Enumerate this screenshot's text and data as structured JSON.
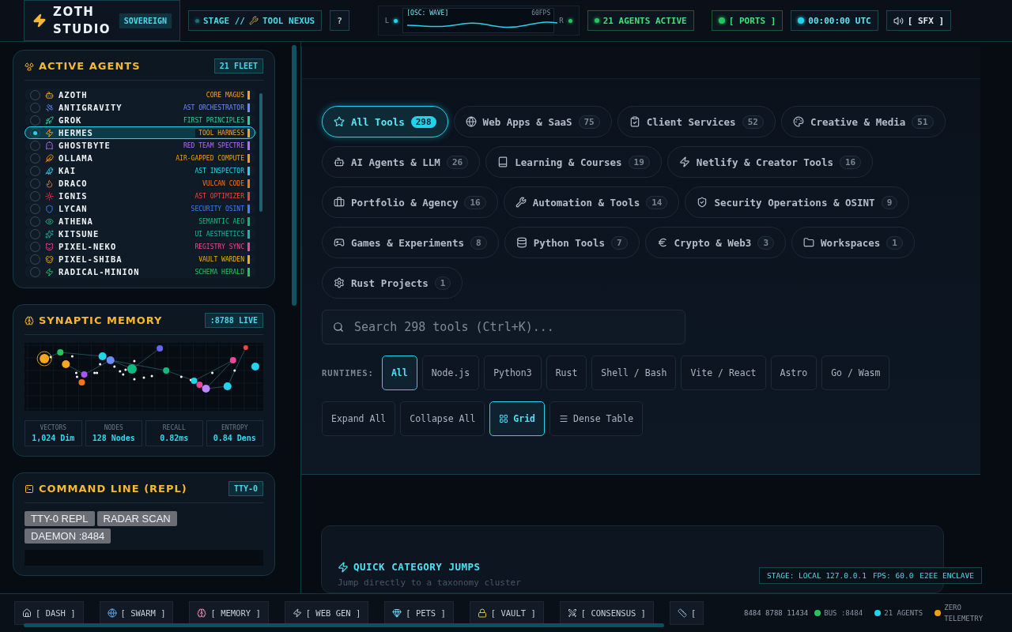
{
  "topbar": {
    "brand": "ZOTH STUDIO",
    "badge": "SOVEREIGN",
    "stage": {
      "prefix": "STAGE //",
      "label": "TOOL NEXUS"
    },
    "help": "?",
    "osc": {
      "left": "L",
      "right": "R",
      "title": "[OSC: WAVE]",
      "fps": "60FPS"
    },
    "agents_status": "21 AGENTS ACTIVE",
    "ports": "[ PORTS ]",
    "clock": "00:00:00 UTC",
    "sfx": "[ SFX ]"
  },
  "agents_panel": {
    "title": "ACTIVE AGENTS",
    "badge": "21 FLEET",
    "agents": [
      {
        "name": "AZOTH",
        "role": "CORE MAGUS",
        "color": "#f5a623",
        "selected": false
      },
      {
        "name": "ANTIGRAVITY",
        "role": "AST ORCHESTRATOR",
        "color": "#6b8cff",
        "selected": false
      },
      {
        "name": "GROK",
        "role": "FIRST PRINCIPLES",
        "color": "#2ecc9a",
        "selected": false
      },
      {
        "name": "HERMES",
        "role": "TOOL HARNESS",
        "color": "#f5a623",
        "selected": true
      },
      {
        "name": "GHOSTBYTE",
        "role": "RED TEAM SPECTRE",
        "color": "#b76cff",
        "selected": false
      },
      {
        "name": "OLLAMA",
        "role": "AIR-GAPPED COMPUTE",
        "color": "#f59e0b",
        "selected": false
      },
      {
        "name": "KAI",
        "role": "AST INSPECTOR",
        "color": "#22d3ee",
        "selected": false
      },
      {
        "name": "DRACO",
        "role": "VULCAN CODE",
        "color": "#f97316",
        "selected": false
      },
      {
        "name": "IGNIS",
        "role": "AST OPTIMIZER",
        "color": "#ef4444",
        "selected": false
      },
      {
        "name": "LYCAN",
        "role": "SECURITY OSINT",
        "color": "#3b82f6",
        "selected": false
      },
      {
        "name": "ATHENA",
        "role": "SEMANTIC AEO",
        "color": "#10b981",
        "selected": false
      },
      {
        "name": "KITSUNE",
        "role": "UI AESTHETICS",
        "color": "#14b8a6",
        "selected": false
      },
      {
        "name": "PIXEL-NEKO",
        "role": "REGISTRY SYNC",
        "color": "#ec4899",
        "selected": false
      },
      {
        "name": "PIXEL-SHIBA",
        "role": "VAULT WARDEN",
        "color": "#eab308",
        "selected": false
      },
      {
        "name": "RADICAL-MINION",
        "role": "SCHEMA HERALD",
        "color": "#22c55e",
        "selected": false
      }
    ]
  },
  "memory_panel": {
    "title": "SYNAPTIC MEMORY",
    "badge": ":8788 LIVE",
    "stats": [
      {
        "label": "VECTORS",
        "value": "1,024 Dim"
      },
      {
        "label": "NODES",
        "value": "128 Nodes"
      },
      {
        "label": "RECALL",
        "value": "0.82ms"
      },
      {
        "label": "ENTROPY",
        "value": "0.84 Dens"
      }
    ]
  },
  "repl_panel": {
    "title": "COMMAND LINE (REPL)",
    "badge": "TTY-0",
    "buttons": [
      "TTY-0 REPL",
      "RADAR SCAN",
      "DAEMON :8484"
    ]
  },
  "categories": [
    {
      "label": "All Tools",
      "count": "298",
      "selected": true
    },
    {
      "label": "Web Apps & SaaS",
      "count": "75",
      "selected": false
    },
    {
      "label": "Client Services",
      "count": "52",
      "selected": false
    },
    {
      "label": "Creative & Media",
      "count": "51",
      "selected": false
    },
    {
      "label": "AI Agents & LLM",
      "count": "26",
      "selected": false
    },
    {
      "label": "Learning & Courses",
      "count": "19",
      "selected": false
    },
    {
      "label": "Netlify & Creator Tools",
      "count": "16",
      "selected": false
    },
    {
      "label": "Portfolio & Agency",
      "count": "16",
      "selected": false
    },
    {
      "label": "Automation & Tools",
      "count": "14",
      "selected": false
    },
    {
      "label": "Security Operations & OSINT",
      "count": "9",
      "selected": false
    },
    {
      "label": "Games & Experiments",
      "count": "8",
      "selected": false
    },
    {
      "label": "Python Tools",
      "count": "7",
      "selected": false
    },
    {
      "label": "Crypto & Web3",
      "count": "3",
      "selected": false
    },
    {
      "label": "Workspaces",
      "count": "1",
      "selected": false
    },
    {
      "label": "Rust Projects",
      "count": "1",
      "selected": false
    }
  ],
  "search": {
    "placeholder": "Search 298 tools (Ctrl+K)..."
  },
  "runtimes": {
    "label": "RUNTIMES:",
    "options": [
      {
        "label": "All",
        "selected": true
      },
      {
        "label": "Node.js",
        "selected": false
      },
      {
        "label": "Python3",
        "selected": false
      },
      {
        "label": "Rust",
        "selected": false
      },
      {
        "label": "Shell / Bash",
        "selected": false
      },
      {
        "label": "Vite / React",
        "selected": false
      },
      {
        "label": "Astro",
        "selected": false
      },
      {
        "label": "Go / Wasm",
        "selected": false
      }
    ]
  },
  "actions": [
    "Expand All",
    "Collapse All"
  ],
  "views": [
    {
      "label": "Grid",
      "selected": true
    },
    {
      "label": "Dense Table",
      "selected": false
    }
  ],
  "quick_jumps": {
    "title": "QUICK CATEGORY JUMPS",
    "subtitle": "Jump directly to a taxonomy cluster"
  },
  "stage_overlay": [
    "STAGE: LOCAL 127.0.0.1",
    "FPS: 60.0",
    "E2EE ENCLAVE"
  ],
  "bottom_nav": [
    "[ DASH ]",
    "[ SWARM ]",
    "[ MEMORY ]",
    "[ WEB GEN ]",
    "[ PETS ]",
    "[ VAULT ]",
    "[ CONSENSUS ]",
    "["
  ],
  "bottom_status": {
    "ports": "8484 8788 11434",
    "indicators": [
      {
        "label": "BUS :8484",
        "color": "#22c55e"
      },
      {
        "label": "21 AGENTS",
        "color": "#22d3ee"
      },
      {
        "label": "ZERO TELEMETRY",
        "color": "#f59e0b"
      }
    ]
  }
}
